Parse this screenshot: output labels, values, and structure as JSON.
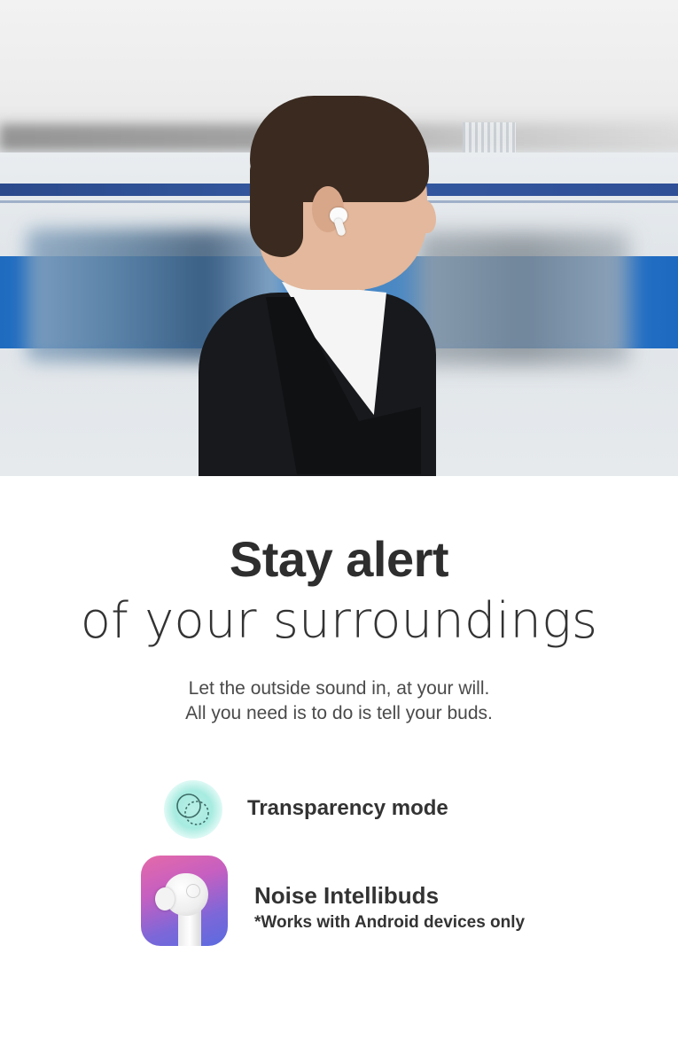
{
  "hero": {
    "image": "man-with-earbud-train-background"
  },
  "headline": {
    "bold": "Stay alert",
    "light": "of your surroundings"
  },
  "subtitle": {
    "line1": "Let the outside sound in, at your will.",
    "line2": "All you need is to do is tell your buds."
  },
  "features": {
    "transparency": {
      "icon": "transparency-mode-icon",
      "label": "Transparency mode"
    },
    "intellibuds": {
      "icon": "noise-app-icon",
      "label": "Noise Intellibuds",
      "note": "*Works with Android devices only"
    }
  },
  "colors": {
    "text": "#2e2e2e",
    "teal_glow": "#a7ebe0",
    "app_gradient_start": "#e56aa8",
    "app_gradient_end": "#5a6be0"
  }
}
